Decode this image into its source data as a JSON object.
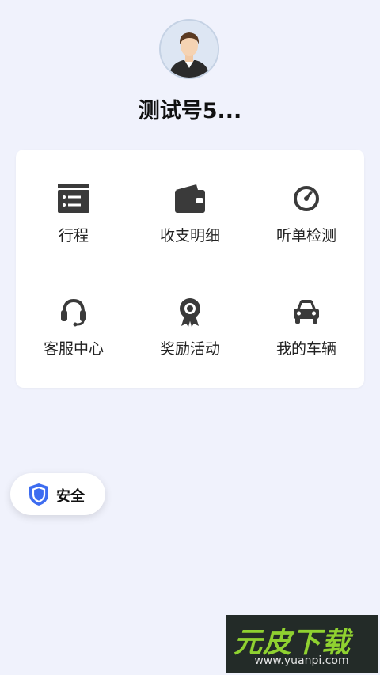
{
  "profile": {
    "name": "测试号5..."
  },
  "menu": {
    "items": [
      {
        "label": "行程",
        "icon": "itinerary-icon"
      },
      {
        "label": "收支明细",
        "icon": "wallet-icon"
      },
      {
        "label": "听单检测",
        "icon": "gauge-icon"
      },
      {
        "label": "客服中心",
        "icon": "headset-icon"
      },
      {
        "label": "奖励活动",
        "icon": "award-icon"
      },
      {
        "label": "我的车辆",
        "icon": "car-icon"
      }
    ]
  },
  "safety": {
    "label": "安全",
    "icon": "shield-icon",
    "color": "#3d6cf0"
  },
  "watermark": {
    "logo": "元皮下载",
    "url": "www.yuanpi.com"
  },
  "colors": {
    "background": "#f0f2fc",
    "icon": "#3a3a3a",
    "accent": "#3d6cf0"
  }
}
